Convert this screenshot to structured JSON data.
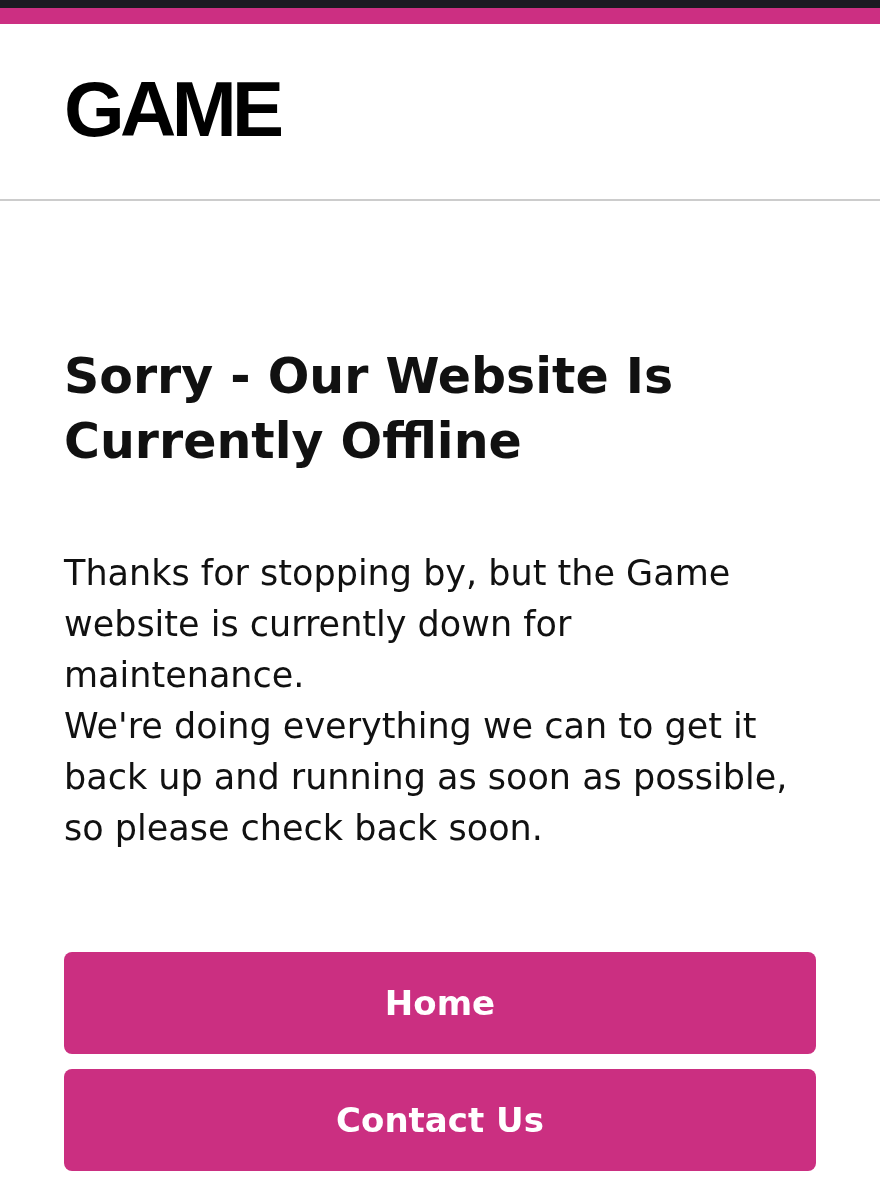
{
  "header": {
    "logo": "GAME"
  },
  "heading": "Sorry - Our Website Is Currently Offline",
  "paragraphs": [
    "Thanks for stopping by, but the Game website is currently down for maintenance.",
    "We're doing everything we can to get it back up and running as soon as possible, so please check back soon."
  ],
  "buttons": [
    {
      "label": "Home"
    },
    {
      "label": "Contact Us"
    }
  ]
}
